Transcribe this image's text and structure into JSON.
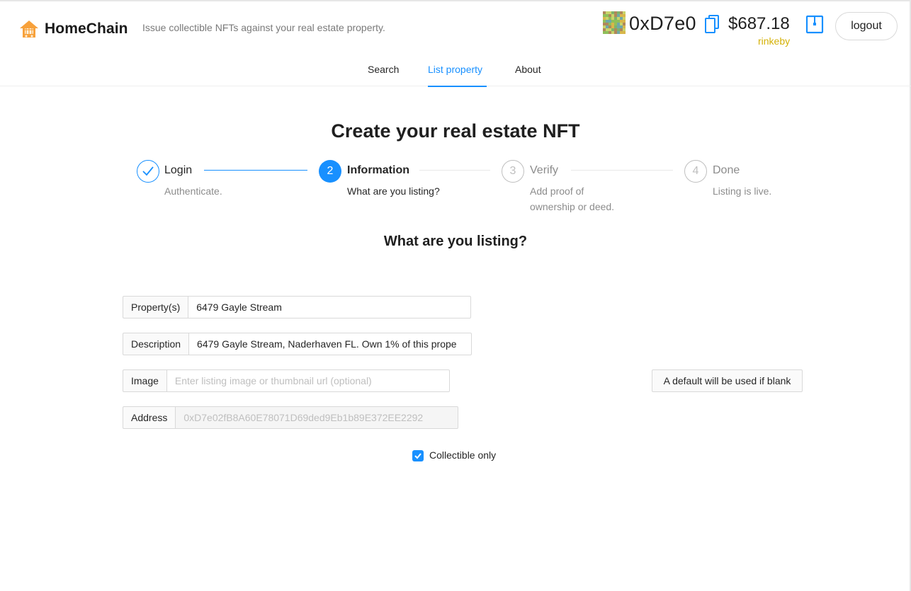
{
  "header": {
    "brand": "HomeChain",
    "tagline": "Issue collectible NFTs against your real estate property.",
    "account": "0xD7e0",
    "balance": "$687.18",
    "network": "rinkeby",
    "logout_label": "logout"
  },
  "nav": {
    "items": [
      {
        "label": "Search"
      },
      {
        "label": "List property"
      },
      {
        "label": "About"
      }
    ],
    "active": "List property"
  },
  "main": {
    "title": "Create your real estate NFT",
    "steps": [
      {
        "number": "",
        "title": "Login",
        "description": "Authenticate.",
        "status": "finish"
      },
      {
        "number": "2",
        "title": "Information",
        "description": "What are you listing?",
        "status": "process"
      },
      {
        "number": "3",
        "title": "Verify",
        "description": "Add proof of ownership or deed.",
        "status": "wait"
      },
      {
        "number": "4",
        "title": "Done",
        "description": "Listing is live.",
        "status": "wait"
      }
    ],
    "section_title": "What are you listing?",
    "form": {
      "property_label": "Property(s)",
      "property_value": "6479 Gayle Stream",
      "description_label": "Description",
      "description_value": "6479 Gayle Stream, Naderhaven FL. Own 1% of this prope",
      "image_label": "Image",
      "image_placeholder": "Enter listing image or thumbnail url (optional)",
      "image_note": "A default will be used if blank",
      "address_label": "Address",
      "address_value": "0xD7e02fB8A60E78071D69ded9Eb1b89E372EE2292",
      "collectible_label": "Collectible only",
      "collectible_checked": true
    }
  },
  "colors": {
    "accent": "#1890ff",
    "network": "#d4b106"
  }
}
